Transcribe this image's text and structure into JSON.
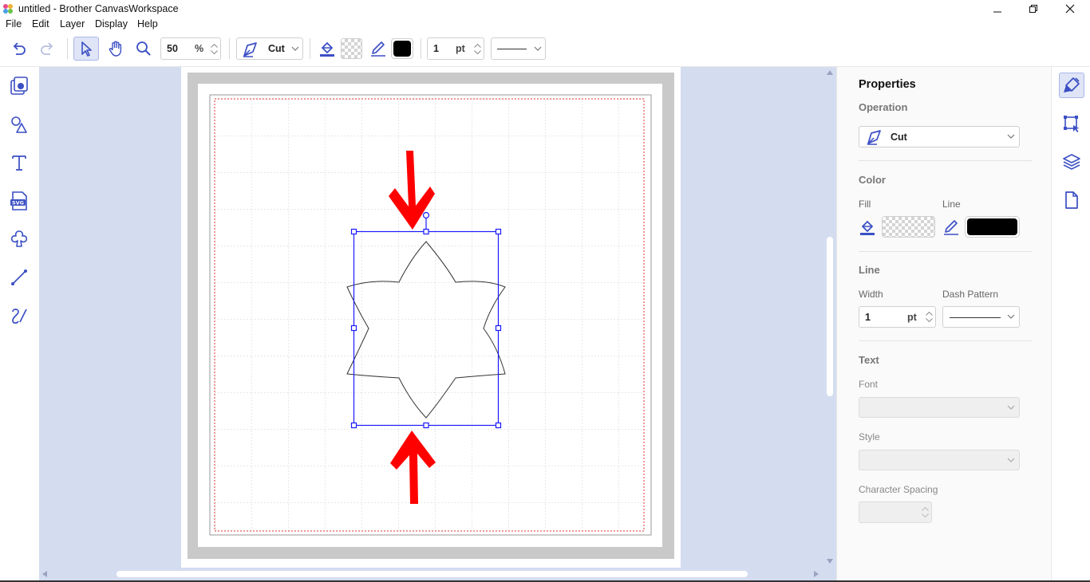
{
  "window": {
    "title": "untitled - Brother CanvasWorkspace"
  },
  "menu": {
    "items": [
      "File",
      "Edit",
      "Layer",
      "Display",
      "Help"
    ]
  },
  "toolbar": {
    "zoom_value": "50",
    "zoom_unit": "%",
    "operation": "Cut",
    "line_width_value": "1",
    "line_width_unit": "pt",
    "line_color": "#000000"
  },
  "properties": {
    "title": "Properties",
    "operation_heading": "Operation",
    "operation_value": "Cut",
    "color_heading": "Color",
    "fill_label": "Fill",
    "line_label": "Line",
    "line_color": "#000000",
    "line_heading": "Line",
    "width_label": "Width",
    "width_value": "1",
    "width_unit": "pt",
    "dash_label": "Dash Pattern",
    "text_heading": "Text",
    "font_label": "Font",
    "style_label": "Style",
    "spacing_label": "Character Spacing"
  },
  "colors": {
    "accent": "#3b4fc4",
    "canvas_bg": "#d4dcf0",
    "selection": "#1a1aff",
    "annotation_arrows": "#ff0000",
    "margin_line": "#e03030"
  },
  "icons": {
    "left_tools": [
      "templates-icon",
      "shapes-icon",
      "text-icon",
      "svg-import-icon",
      "pattern-icon",
      "line-tool-icon",
      "freehand-icon"
    ],
    "right_tabs": [
      "properties-brush-icon",
      "transform-icon",
      "layers-icon",
      "page-icon"
    ]
  }
}
